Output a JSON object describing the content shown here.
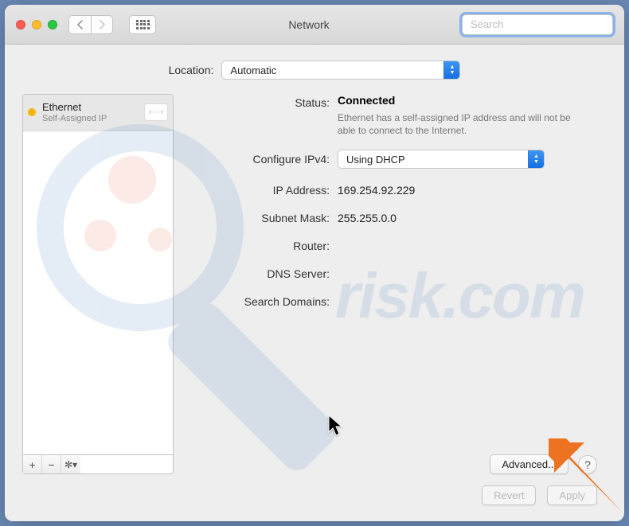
{
  "window": {
    "title": "Network",
    "search_placeholder": "Search",
    "location_label": "Location:",
    "location_value": "Automatic"
  },
  "sidebar": {
    "items": [
      {
        "name": "Ethernet",
        "subtitle": "Self-Assigned IP",
        "status_color": "#f5b400",
        "sync_glyph": "‹···›"
      }
    ],
    "add_label": "+",
    "remove_label": "−",
    "gear_label": "✻▾"
  },
  "main": {
    "status_label": "Status:",
    "status_value": "Connected",
    "status_desc": "Ethernet has a self-assigned IP address and will not be able to connect to the Internet.",
    "configure_label": "Configure IPv4:",
    "configure_value": "Using DHCP",
    "ip_label": "IP Address:",
    "ip_value": "169.254.92.229",
    "subnet_label": "Subnet Mask:",
    "subnet_value": "255.255.0.0",
    "router_label": "Router:",
    "router_value": "",
    "dns_label": "DNS Server:",
    "dns_value": "",
    "search_domains_label": "Search Domains:",
    "search_domains_value": "",
    "advanced_label": "Advanced...",
    "help_label": "?"
  },
  "footer": {
    "revert_label": "Revert",
    "apply_label": "Apply"
  },
  "watermark_text": "risk.com"
}
